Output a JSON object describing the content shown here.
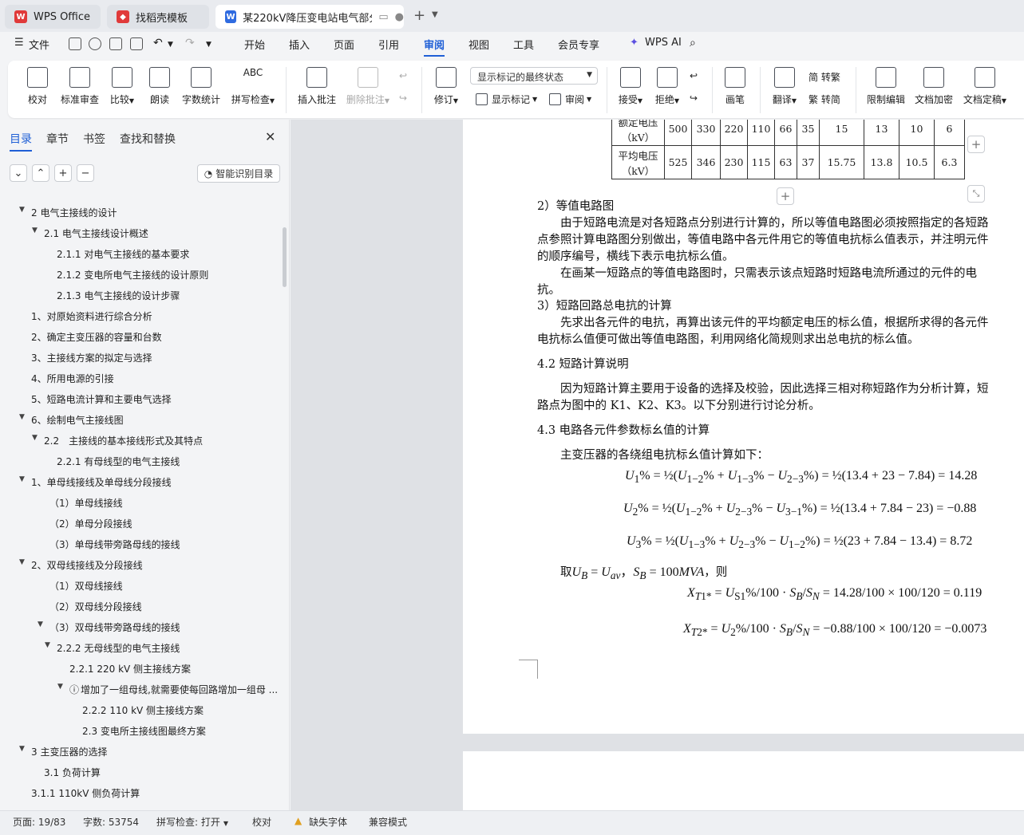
{
  "tabs": [
    {
      "label": "WPS Office"
    },
    {
      "label": "找稻壳模板"
    },
    {
      "label": "某220kV降压变电站电气部分..."
    }
  ],
  "menu": {
    "file": "文件",
    "items": [
      "开始",
      "插入",
      "页面",
      "引用",
      "审阅",
      "视图",
      "工具",
      "会员专享"
    ],
    "active": "审阅",
    "wps_ai": "WPS AI"
  },
  "ribbon": {
    "proofread": "校对",
    "std_review": "标准审查",
    "compare": "比较",
    "read_aloud": "朗读",
    "word_count": "字数统计",
    "spell_check": "拼写检查",
    "insert_comment": "插入批注",
    "delete_comment": "删除批注",
    "revise": "修订",
    "markup_state": "显示标记的最终状态",
    "show_markup": "显示标记",
    "review": "审阅",
    "accept": "接受",
    "reject": "拒绝",
    "pen": "画笔",
    "translate": "翻译",
    "to_trad": "简 转繁",
    "to_simp": "繁 转简",
    "restrict": "限制编辑",
    "encrypt": "文档加密",
    "finalize": "文档定稿"
  },
  "sidebar": {
    "tabs": [
      "目录",
      "章节",
      "书签",
      "查找和替换"
    ],
    "active_tab": "目录",
    "smart_button": "智能识别目录",
    "toc": [
      "2 电气主接线的设计",
      "2.1 电气主接线设计概述",
      "2.1.1 对电气主接线的基本要求",
      "2.1.2 变电所电气主接线的设计原则",
      "2.1.3 电气主接线的设计步骤",
      "1、对原始资料进行综合分析",
      "2、确定主变压器的容量和台数",
      "3、主接线方案的拟定与选择",
      "4、所用电源的引接",
      "5、短路电流计算和主要电气选择",
      "6、绘制电气主接线图",
      "2.2　主接线的基本接线形式及其特点",
      "2.2.1 有母线型的电气主接线",
      "1、单母线接线及单母线分段接线",
      "（1）单母线接线",
      "（2）单母分段接线",
      "（3）单母线带旁路母线的接线",
      "2、双母线接线及分段接线",
      "（1）双母线接线",
      "（2）双母线分段接线",
      "（3）双母线带旁路母线的接线",
      "2.2.2 无母线型的电气主接线",
      "2.2.1 220 kV 侧主接线方案",
      "增加了一组母线,就需要使每回路增加一组母 ...",
      "2.2.2 110 kV 侧主接线方案",
      "2.3 变电所主接线图最终方案",
      "3 主变压器的选择",
      "3.1 负荷计算",
      "3.1.1 110kV 侧负荷计算"
    ]
  },
  "doc": {
    "table_row1_label": "额定电压（kV）",
    "table_row1": [
      "500",
      "330",
      "220",
      "110",
      "66",
      "35",
      "15",
      "13",
      "10",
      "6"
    ],
    "table_row2_label": "平均电压（kV）",
    "table_row2": [
      "525",
      "346",
      "230",
      "115",
      "63",
      "37",
      "15.75",
      "13.8",
      "10.5",
      "6.3"
    ],
    "p1": "2）等值电路图",
    "p2": "　　由于短路电流是对各短路点分别进行计算的，所以等值电路图必须按照指定的各短路",
    "p3": "点参照计算电路图分别做出，等值电路中各元件用它的等值电抗标么值表示，并注明元件",
    "p4": "的顺序编号，横线下表示电抗标么值。",
    "p5": "　　在画某一短路点的等值电路图时，只需表示该点短路时短路电流所通过的元件的电",
    "p6": "抗。",
    "p7": "3）短路回路总电抗的计算",
    "p8": "　　先求出各元件的电抗，再算出该元件的平均额定电压的标么值，根据所求得的各元件",
    "p9": "电抗标么值便可做出等值电路图，利用网络化简规则求出总电抗的标么值。",
    "h1": "4.2 短路计算说明",
    "p10": "　　因为短路计算主要用于设备的选择及校验，因此选择三相对称短路作为分析计算，短",
    "p11": "路点为图中的 K1、K2、K3。以下分别进行讨论分析。",
    "h2": "4.3 电路各元件参数标幺值的计算",
    "p12": "　　主变压器的各绕组电抗标幺值计算如下：",
    "eq1_rhs": "(13.4 + 23 − 7.84) = 14.28",
    "eq2_rhs": "(13.4 + 7.84 − 23) = −0.88",
    "eq3_rhs": "(23 + 7.84 − 13.4) = 8.72",
    "take": "　　取",
    "then": "，则",
    "eq4_val": "0.119",
    "eq5_val": "−0.0073"
  },
  "status": {
    "page": "页面: 19/83",
    "words": "字数: 53754",
    "spell": "拼写检查: 打开",
    "proof": "校对",
    "missing_font": "缺失字体",
    "compat": "兼容模式"
  }
}
